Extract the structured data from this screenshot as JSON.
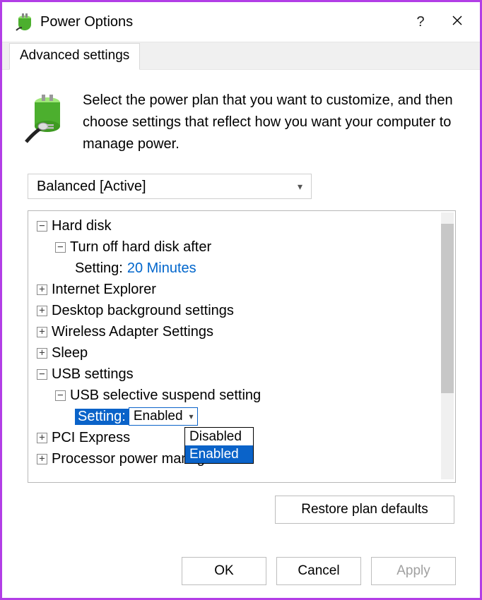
{
  "window": {
    "title": "Power Options",
    "help_symbol": "?",
    "tab_label": "Advanced settings",
    "intro": "Select the power plan that you want to customize, and then choose settings that reflect how you want your computer to manage power."
  },
  "plan_select": {
    "value": "Balanced [Active]"
  },
  "tree": {
    "hard_disk": "Hard disk",
    "hd_turnoff": "Turn off hard disk after",
    "hd_setting_label": "Setting:",
    "hd_setting_value": "20 Minutes",
    "ie": "Internet Explorer",
    "desktop_bg": "Desktop background settings",
    "wireless": "Wireless Adapter Settings",
    "sleep": "Sleep",
    "usb": "USB settings",
    "usb_suspend": "USB selective suspend setting",
    "usb_setting_label": "Setting:",
    "usb_setting_value": "Enabled",
    "pci": "PCI Express",
    "cpu": "Processor power management"
  },
  "dropdown": {
    "opt_disabled": "Disabled",
    "opt_enabled": "Enabled"
  },
  "buttons": {
    "restore": "Restore plan defaults",
    "ok": "OK",
    "cancel": "Cancel",
    "apply": "Apply"
  },
  "expanders": {
    "plus": "+",
    "minus": "−"
  }
}
